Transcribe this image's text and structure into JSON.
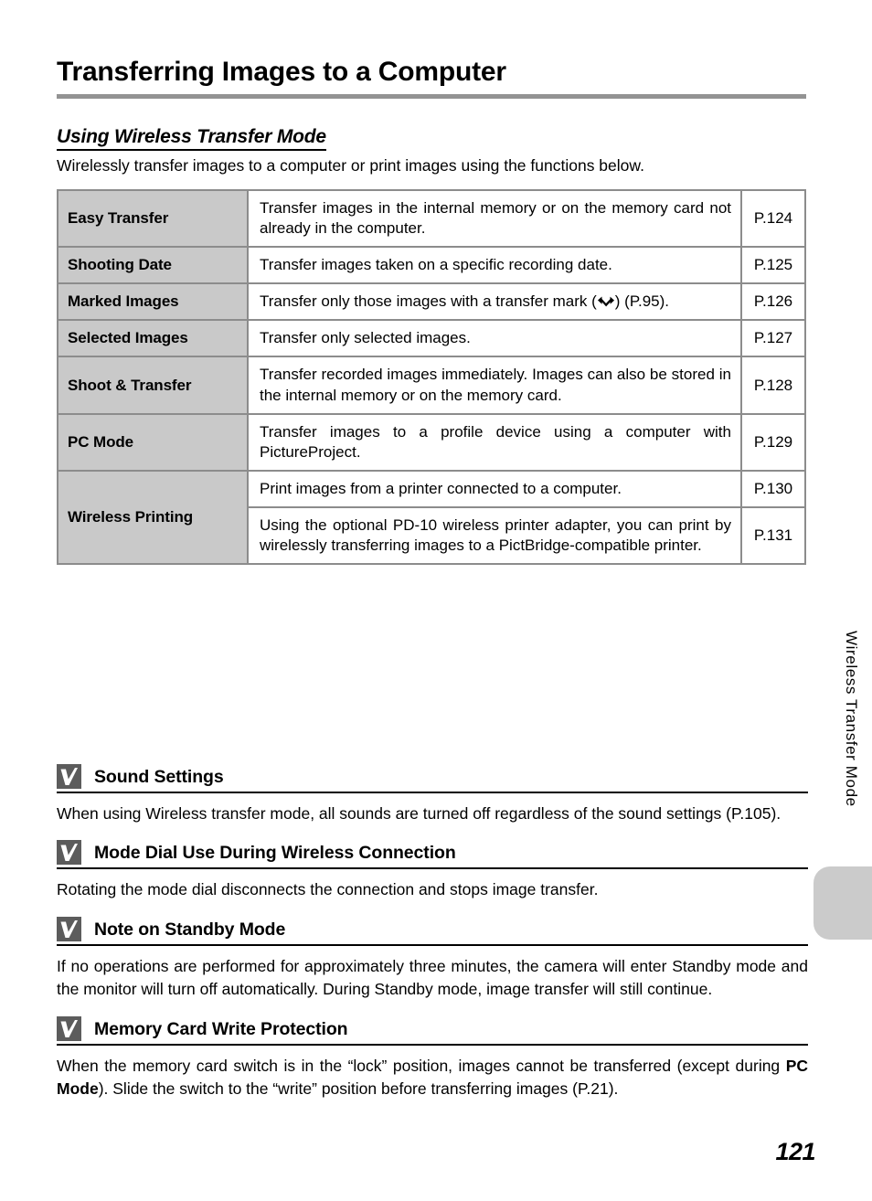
{
  "document": {
    "title": "Transferring Images to a Computer",
    "subtitle": "Using Wireless Transfer Mode",
    "intro": "Wirelessly transfer images to a computer or print images using the functions below.",
    "page_number": "121",
    "side_tab_label": "Wireless Transfer Mode"
  },
  "table": {
    "rows": [
      {
        "label": "Easy Transfer",
        "description": "Transfer images in the internal memory or on the memory card not already in the computer.",
        "page": "P.124"
      },
      {
        "label": "Shooting Date",
        "description": "Transfer images taken on a specific recording date.",
        "page": "P.125"
      },
      {
        "label": "Marked Images",
        "description_before": "Transfer only those images with a transfer mark (",
        "description_after": ") (P.95).",
        "icon": "transfer-mark-icon",
        "page": "P.126"
      },
      {
        "label": "Selected Images",
        "description": "Transfer only selected images.",
        "page": "P.127"
      },
      {
        "label": "Shoot & Transfer",
        "description": "Transfer recorded images immediately. Images can also be stored in the internal memory or on the memory card.",
        "page": "P.128"
      },
      {
        "label": "PC Mode",
        "description": "Transfer images to a profile device using a computer with PictureProject.",
        "page": "P.129"
      },
      {
        "label": "Wireless Printing",
        "description": "Print images from a printer connected to a computer.",
        "page": "P.130"
      },
      {
        "label": "",
        "description": "Using the optional PD-10 wireless printer adapter, you can print by wirelessly transferring images to a PictBridge-compatible printer.",
        "page": "P.131"
      }
    ]
  },
  "notes": [
    {
      "icon": "check-mark-icon",
      "title": "Sound Settings",
      "body": "When using Wireless transfer mode, all sounds are turned off regardless of the sound settings (P.105)."
    },
    {
      "icon": "check-mark-icon",
      "title": "Mode Dial Use During Wireless Connection",
      "body": "Rotating the mode dial disconnects the connection and stops image transfer."
    },
    {
      "icon": "check-mark-icon",
      "title": "Note on Standby Mode",
      "body": "If no operations are performed for approximately three minutes, the camera will enter Standby mode and the monitor will turn off automatically. During Standby mode, image transfer will still continue."
    },
    {
      "icon": "check-mark-icon",
      "title": "Memory Card Write Protection",
      "body_part1": "When the memory card switch is in the “lock” position, images cannot be transferred (except during ",
      "body_bold": "PC Mode",
      "body_part2": "). Slide the switch to the “write” position before transferring images (P.21)."
    }
  ],
  "colors": {
    "rule": "#939393",
    "table_border": "#8c8c8c",
    "label_cell_bg": "#c9c9c9",
    "side_tab_bg": "#cbcbcb",
    "icon_bg": "#5c5c5c"
  }
}
